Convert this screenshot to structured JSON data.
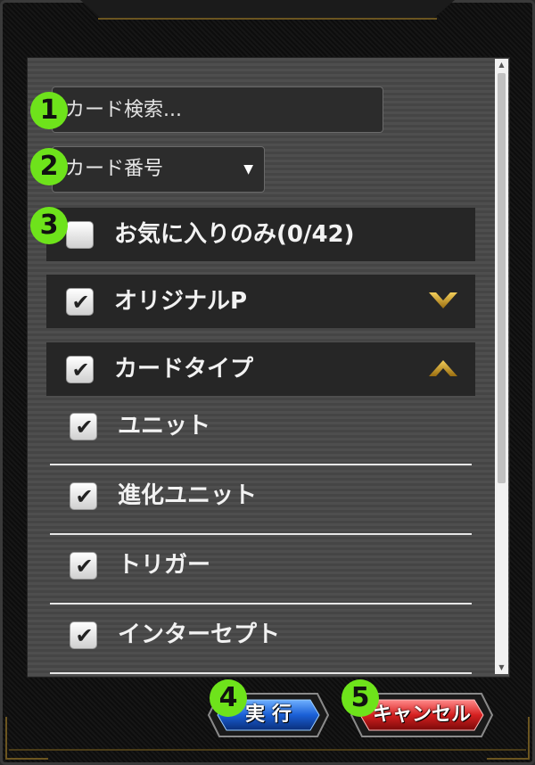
{
  "search": {
    "placeholder": "カード検索..."
  },
  "sort_select": {
    "value": "カード番号"
  },
  "favorites": {
    "label": "お気に入りのみ(0/42)",
    "checked": false
  },
  "sections": [
    {
      "label": "オリジナルP",
      "checked": true,
      "expanded": false
    },
    {
      "label": "カードタイプ",
      "checked": true,
      "expanded": true
    }
  ],
  "card_types": [
    {
      "label": "ユニット",
      "checked": true
    },
    {
      "label": "進化ユニット",
      "checked": true
    },
    {
      "label": "トリガー",
      "checked": true
    },
    {
      "label": "インターセプト",
      "checked": true
    }
  ],
  "buttons": {
    "execute_label": "実 行",
    "cancel_label": "キャンセル"
  },
  "badges": [
    "1",
    "2",
    "3",
    "4",
    "5"
  ],
  "checkmark": "✔",
  "colors": {
    "badge": "#6ee31b",
    "execute": "#1a5fd6",
    "cancel": "#d62020",
    "chevron": "#d9a520"
  }
}
